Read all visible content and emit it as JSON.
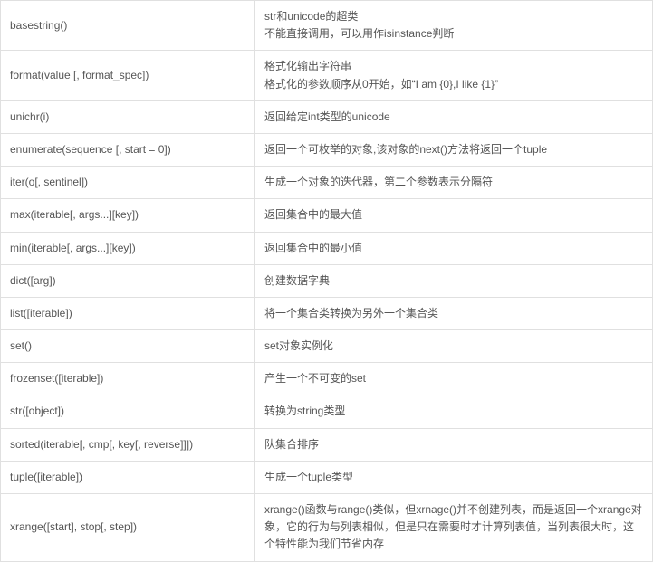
{
  "rows": [
    {
      "func": "basestring()",
      "desc": "str和unicode的超类\n不能直接调用，可以用作isinstance判断"
    },
    {
      "func": "format(value [, format_spec])",
      "desc": "格式化输出字符串\n格式化的参数顺序从0开始，如“I am {0},I like {1}”"
    },
    {
      "func": "unichr(i)",
      "desc": "返回给定int类型的unicode"
    },
    {
      "func": "enumerate(sequence [, start = 0])",
      "desc": "返回一个可枚举的对象,该对象的next()方法将返回一个tuple"
    },
    {
      "func": "iter(o[, sentinel])",
      "desc": "生成一个对象的迭代器，第二个参数表示分隔符"
    },
    {
      "func": "max(iterable[, args...][key])",
      "desc": "返回集合中的最大值"
    },
    {
      "func": "min(iterable[, args...][key])",
      "desc": "返回集合中的最小值"
    },
    {
      "func": "dict([arg])",
      "desc": "创建数据字典"
    },
    {
      "func": "list([iterable])",
      "desc": "将一个集合类转换为另外一个集合类"
    },
    {
      "func": "set()",
      "desc": "set对象实例化"
    },
    {
      "func": "frozenset([iterable])",
      "desc": "产生一个不可变的set"
    },
    {
      "func": "str([object])",
      "desc": "转换为string类型"
    },
    {
      "func": "sorted(iterable[, cmp[, key[, reverse]]])",
      "desc": "队集合排序"
    },
    {
      "func": "tuple([iterable])",
      "desc": "生成一个tuple类型"
    },
    {
      "func": "xrange([start], stop[, step])",
      "desc": "xrange()函数与range()类似，但xrnage()并不创建列表，而是返回一个xrange对象，它的行为与列表相似，但是只在需要时才计算列表值，当列表很大时，这个特性能为我们节省内存"
    }
  ]
}
